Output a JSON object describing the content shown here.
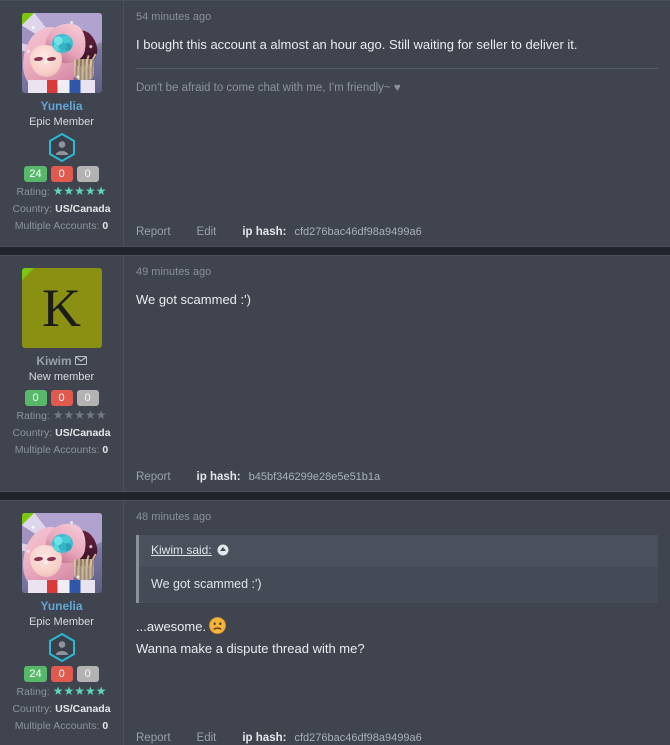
{
  "theme": {
    "page_bg": "#21252b",
    "post_bg": "#3f444e",
    "accent_username": "#63a6d4",
    "star_color": "#5fd4bc",
    "badge_positive": "#56b868",
    "badge_negative": "#e05a4e",
    "badge_neutral": "#b3b3b3"
  },
  "labels": {
    "rating": "Rating:",
    "country": "Country:",
    "multiple_accounts": "Multiple Accounts:",
    "report": "Report",
    "edit": "Edit",
    "ip_hash": "ip hash:"
  },
  "posts": [
    {
      "timestamp": "54 minutes ago",
      "message": "I bought this account a almost an hour ago. Still waiting for seller to deliver it.",
      "signature": "Don't be afraid to come chat with me, I'm friendly~ ♥",
      "user": {
        "name": "Yunelia",
        "title": "Epic Member",
        "avatar_type": "anime",
        "avatar_letter": "",
        "rating_stars": 5,
        "rating_active": true,
        "country": "US/Canada",
        "multiple_accounts": "0",
        "has_envelope": false,
        "badges": {
          "positive": "24",
          "negative": "0",
          "neutral": "0"
        }
      },
      "footer": {
        "report": "Report",
        "edit": "Edit",
        "ip_hash_label": "ip hash:",
        "ip_hash_value": "cfd276bac46df98a9499a6",
        "has_edit": true
      }
    },
    {
      "timestamp": "49 minutes ago",
      "message": "We got scammed :')",
      "signature": "",
      "user": {
        "name": "Kiwim",
        "title": "New member",
        "avatar_type": "letter",
        "avatar_letter": "K",
        "rating_stars": 5,
        "rating_active": false,
        "country": "US/Canada",
        "multiple_accounts": "0",
        "has_envelope": true,
        "badges": {
          "positive": "0",
          "negative": "0",
          "neutral": "0"
        }
      },
      "footer": {
        "report": "Report",
        "edit": "",
        "ip_hash_label": "ip hash:",
        "ip_hash_value": "b45bf346299e28e5e51b1a",
        "has_edit": false
      }
    },
    {
      "timestamp": "48 minutes ago",
      "quote": {
        "author_said": "Kiwim said:",
        "text": "We got scammed :')"
      },
      "message": "...awesome.",
      "message2": "Wanna make a dispute thread with me?",
      "signature": "",
      "user": {
        "name": "Yunelia",
        "title": "Epic Member",
        "avatar_type": "anime",
        "avatar_letter": "",
        "rating_stars": 5,
        "rating_active": true,
        "country": "US/Canada",
        "multiple_accounts": "0",
        "has_envelope": false,
        "badges": {
          "positive": "24",
          "negative": "0",
          "neutral": "0"
        }
      },
      "footer": {
        "report": "Report",
        "edit": "Edit",
        "ip_hash_label": "ip hash:",
        "ip_hash_value": "cfd276bac46df98a9499a6",
        "has_edit": true
      }
    }
  ]
}
